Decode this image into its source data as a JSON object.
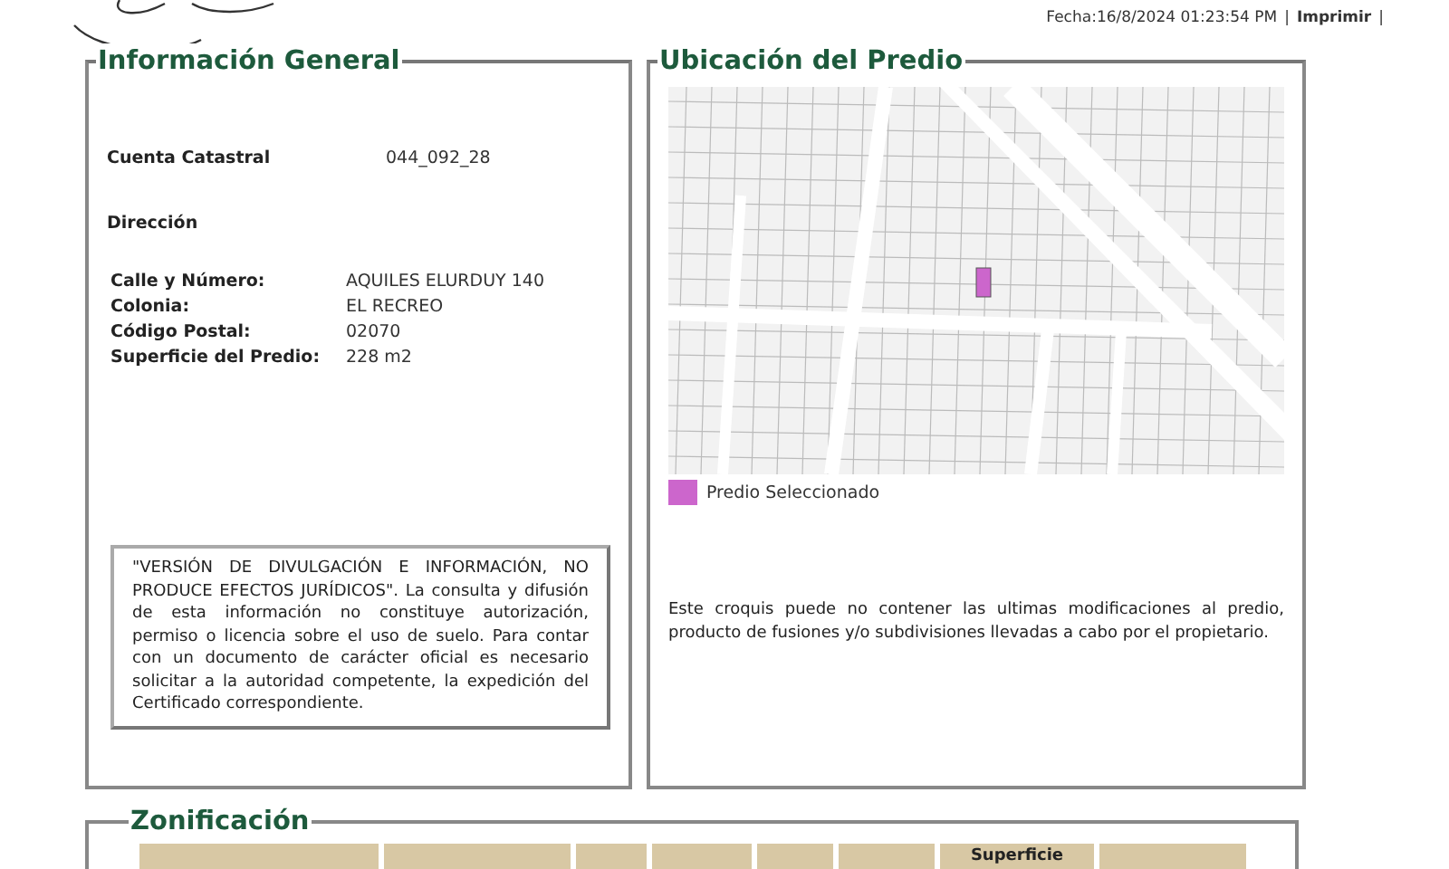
{
  "header": {
    "date": "Fecha:16/8/2024 01:23:54 PM",
    "separator": "|",
    "print_link": "Imprimir",
    "trailing_separator": "|"
  },
  "general": {
    "title": "Información General",
    "account": {
      "label": "Cuenta Catastral",
      "value": "044_092_28"
    },
    "address_title": "Dirección",
    "fields": [
      {
        "label": "Calle y Número:",
        "value": "AQUILES ELURDUY 140"
      },
      {
        "label": "Colonia:",
        "value": "EL RECREO"
      },
      {
        "label": "Código Postal:",
        "value": "02070"
      },
      {
        "label": "Superficie del Predio:",
        "value": "228 m2"
      }
    ],
    "disclaimer": "\"VERSIÓN DE DIVULGACIÓN E INFORMACIÓN, NO PRODUCE EFECTOS JURÍDICOS\". La consulta y difusión de esta información no constituye autorización, permiso o licencia sobre el uso de suelo. Para contar con un documento de carácter oficial es necesario solicitar a la autoridad competente, la expedición del Certificado correspondiente."
  },
  "location": {
    "title": "Ubicación del Predio",
    "legend": {
      "label": "Predio Seleccionado",
      "color": "#cc66cc"
    },
    "note": "Este croquis puede no contener las ultimas modificaciones al predio, producto de fusiones y/o subdivisiones llevadas a cabo por el propietario."
  },
  "zoning": {
    "title": "Zonificación",
    "columns": [
      {
        "kind": "blank"
      },
      {
        "kind": "blank"
      },
      {
        "kind": "blank"
      },
      {
        "kind": "blank"
      },
      {
        "kind": "blank"
      },
      {
        "kind": "blank"
      },
      {
        "kind": "text",
        "label": "Superficie"
      },
      {
        "kind": "blank"
      }
    ]
  }
}
